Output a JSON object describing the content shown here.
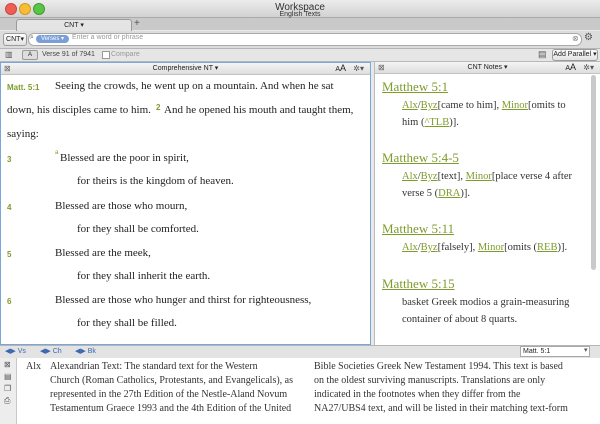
{
  "window": {
    "title": "Workspace",
    "subtitle": "English Texts"
  },
  "tab": {
    "label": "CNT"
  },
  "toolbar": {
    "version_label": "CNT",
    "scope_label": "Verses",
    "search_placeholder": "Enter a word or phrase",
    "add_parallel": "Add Parallel"
  },
  "navbar": {
    "position": "Verse 91 of 7941",
    "compare": "Compare"
  },
  "left_pane": {
    "title": "Comprehensive NT",
    "ref": "Matt. 5:1",
    "lines": [
      "Seeing the crowds, he went up on a mountain. And when he sat",
      "down, his disciples came to him.",
      "And he opened his mouth and taught them,",
      "saying:"
    ],
    "verse2": "2",
    "verses": [
      {
        "num": "3",
        "a": "Blessed are the poor in spirit,",
        "b": "for theirs is the kingdom of heaven."
      },
      {
        "num": "4",
        "a": "Blessed are those who mourn,",
        "b": "for they shall be comforted."
      },
      {
        "num": "5",
        "a": "Blessed are the meek,",
        "b": "for they shall inherit the earth."
      },
      {
        "num": "6",
        "a": "Blessed are those who hunger and thirst for righteousness,",
        "b": "for they shall be filled."
      }
    ],
    "footnote_mark": "a"
  },
  "right_pane": {
    "title": "CNT Notes",
    "notes": [
      {
        "heading": "Matthew 5:1",
        "l1a": "Alx",
        "l1b": "Byz",
        "l1c": "[came to him], ",
        "l1d": "Minor",
        "l1e": "[omits to",
        "l2": "him (",
        "l2link": "^TLB",
        "l2end": ")]."
      },
      {
        "heading": "Matthew 5:4-5",
        "l1a": "Alx",
        "l1b": "Byz",
        "l1c": "[text], ",
        "l1d": "Minor",
        "l1e": "[place verse 4 after",
        "l2": "verse 5 (",
        "l2link": "DRA",
        "l2end": ")]."
      },
      {
        "heading": "Matthew 5:11",
        "l1a": "Alx",
        "l1b": "Byz",
        "l1c": "[falsely], ",
        "l1d": "Minor",
        "l1e": "[omits (",
        "l1link": "REB",
        "l1end": ")]."
      },
      {
        "heading": "Matthew 5:15",
        "p1": "basket Greek modios a grain-measuring",
        "p2": "container of about 8 quarts."
      }
    ]
  },
  "bottombar": {
    "vs": "Vs",
    "ch": "Ch",
    "bk": "Bk",
    "ref": "Matt. 5:1"
  },
  "info": {
    "abbr": "Alx",
    "col1": [
      "Alexandrian Text: The standard text for the Western",
      "Church (Roman Catholics, Protestants, and Evangelicals), as",
      "represented in the 27th Edition of the Nestle-Aland Novum",
      "Testamentum Graece 1993 and the 4th Edition of the United"
    ],
    "col2": [
      "Bible Societies Greek New Testament 1994. This text is based",
      "on the oldest surviving manuscripts. Translations are only",
      "indicated in the footnotes when they differ from the",
      "NA27/UBS4 text, and will be listed in their matching text-form"
    ]
  }
}
